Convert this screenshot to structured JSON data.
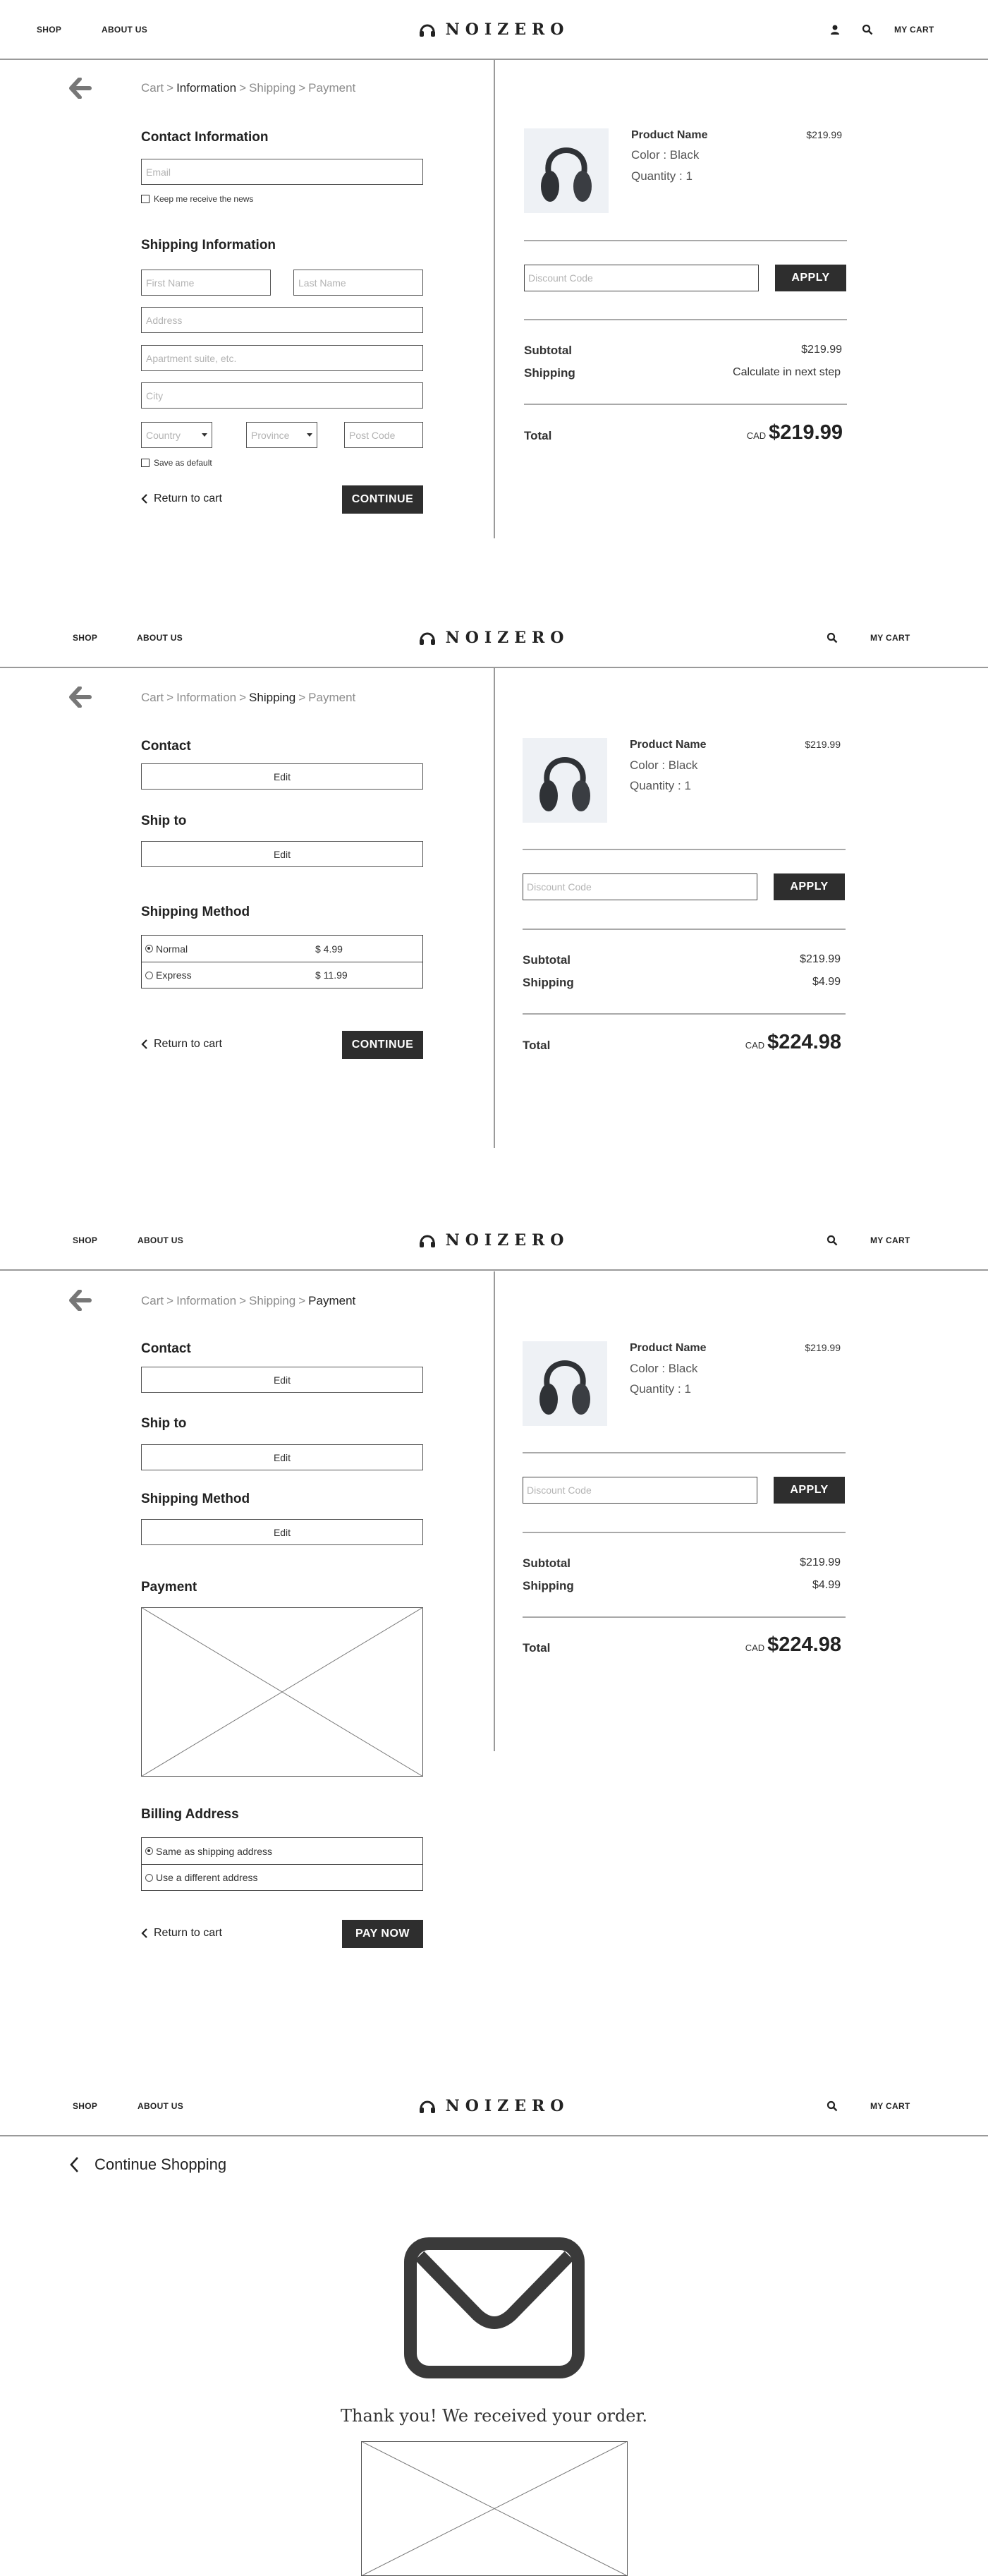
{
  "header": {
    "shop": "SHOP",
    "about": "ABOUT US",
    "logo": "NOIZERO",
    "cart": "MY CART"
  },
  "crumbs": {
    "cart": "Cart",
    "information": "Information",
    "shipping": "Shipping",
    "payment": "Payment",
    "sep": ">"
  },
  "info_step": {
    "contact_title": "Contact Information",
    "email_placeholder": "Email",
    "news_label": "Keep me receive the news",
    "shipping_title": "Shipping Information",
    "first_name": "First Name",
    "last_name": "Last Name",
    "address": "Address",
    "apartment": "Apartment suite, etc.",
    "city": "City",
    "country": "Country",
    "province": "Province",
    "post_code": "Post Code",
    "save_default": "Save as default"
  },
  "common": {
    "contact_title": "Contact",
    "ship_to_title": "Ship to",
    "shipping_method_title": "Shipping Method",
    "payment_title": "Payment",
    "billing_title": "Billing Address",
    "edit": "Edit",
    "return_to_cart": "Return to cart",
    "continue": "CONTINUE",
    "pay_now": "PAY NOW"
  },
  "shipping_options": [
    {
      "label": "Normal",
      "price": "$ 4.99",
      "selected": true
    },
    {
      "label": "Express",
      "price": "$ 11.99",
      "selected": false
    }
  ],
  "billing_options": [
    {
      "label": "Same as shipping address",
      "selected": true
    },
    {
      "label": "Use a different address",
      "selected": false
    }
  ],
  "summary": {
    "product_name": "Product Name",
    "color": "Color : Black",
    "quantity": "Quantity : 1",
    "price": "$219.99",
    "discount_placeholder": "Discount Code",
    "apply": "APPLY",
    "subtotal_label": "Subtotal",
    "subtotal": "$219.99",
    "shipping_label": "Shipping",
    "shipping_pending": "Calculate in next step",
    "shipping_cost": "$4.99",
    "total_label": "Total",
    "currency": "CAD",
    "total_initial": "$219.99",
    "total_final": "$224.98"
  },
  "confirmation": {
    "continue_shopping": "Continue Shopping",
    "thanks": "Thank you! We received your order."
  }
}
